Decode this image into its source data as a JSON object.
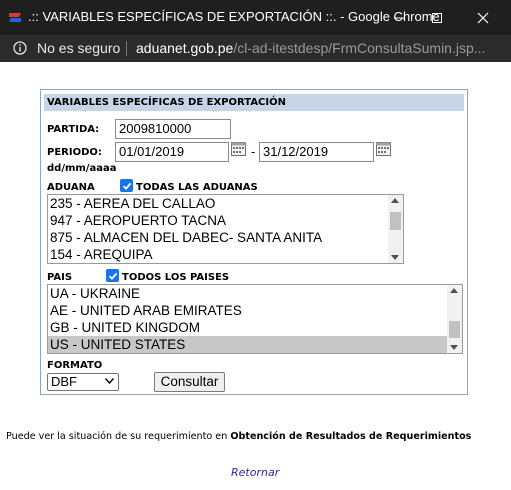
{
  "window": {
    "title": ".:: VARIABLES ESPECÍFICAS DE EXPORTACIÓN ::. - Google Chrome"
  },
  "address_bar": {
    "security_text": "No es seguro",
    "url_host": "aduanet.gob.pe",
    "url_path": "/cl-ad-itestdesp/FrmConsultaSumin.jsp..."
  },
  "form": {
    "header": "VARIABLES ESPECÍFICAS DE EXPORTACIÓN",
    "partida_label": "PARTIDA:",
    "partida_value": "2009810000",
    "periodo_label": "PERIODO:",
    "periodo_from": "01/01/2019",
    "periodo_separator": "-",
    "periodo_to": "31/12/2019",
    "date_format": "dd/mm/aaaa",
    "aduana_label": "ADUANA",
    "aduana_all_label": "TODAS LAS ADUANAS",
    "aduana_all_checked": true,
    "aduanas": [
      "235 - AEREA DEL CALLAO",
      "947 - AEROPUERTO TACNA",
      "875 - ALMACEN DEL DABEC- SANTA ANITA",
      "154 - AREQUIPA"
    ],
    "pais_label": "PAIS",
    "pais_all_label": "TODOS LOS PAISES",
    "pais_all_checked": true,
    "paises": [
      "UA - UKRAINE",
      "AE - UNITED ARAB EMIRATES",
      "GB - UNITED KINGDOM",
      "US - UNITED STATES"
    ],
    "pais_selected": "US - UNITED STATES",
    "formato_label": "FORMATO",
    "formato_value": "DBF",
    "submit_label": "Consultar"
  },
  "footer": {
    "note_prefix": "Puede ver la situación de su requerimiento en",
    "note_link": "Obtención de Resultados de Requerimientos",
    "return_link": "Retornar"
  },
  "colors": {
    "header_bg": "#c6d4e8",
    "border": "#8aa5c8",
    "checkbox": "#1a73e8",
    "link": "#2a2aa8"
  }
}
